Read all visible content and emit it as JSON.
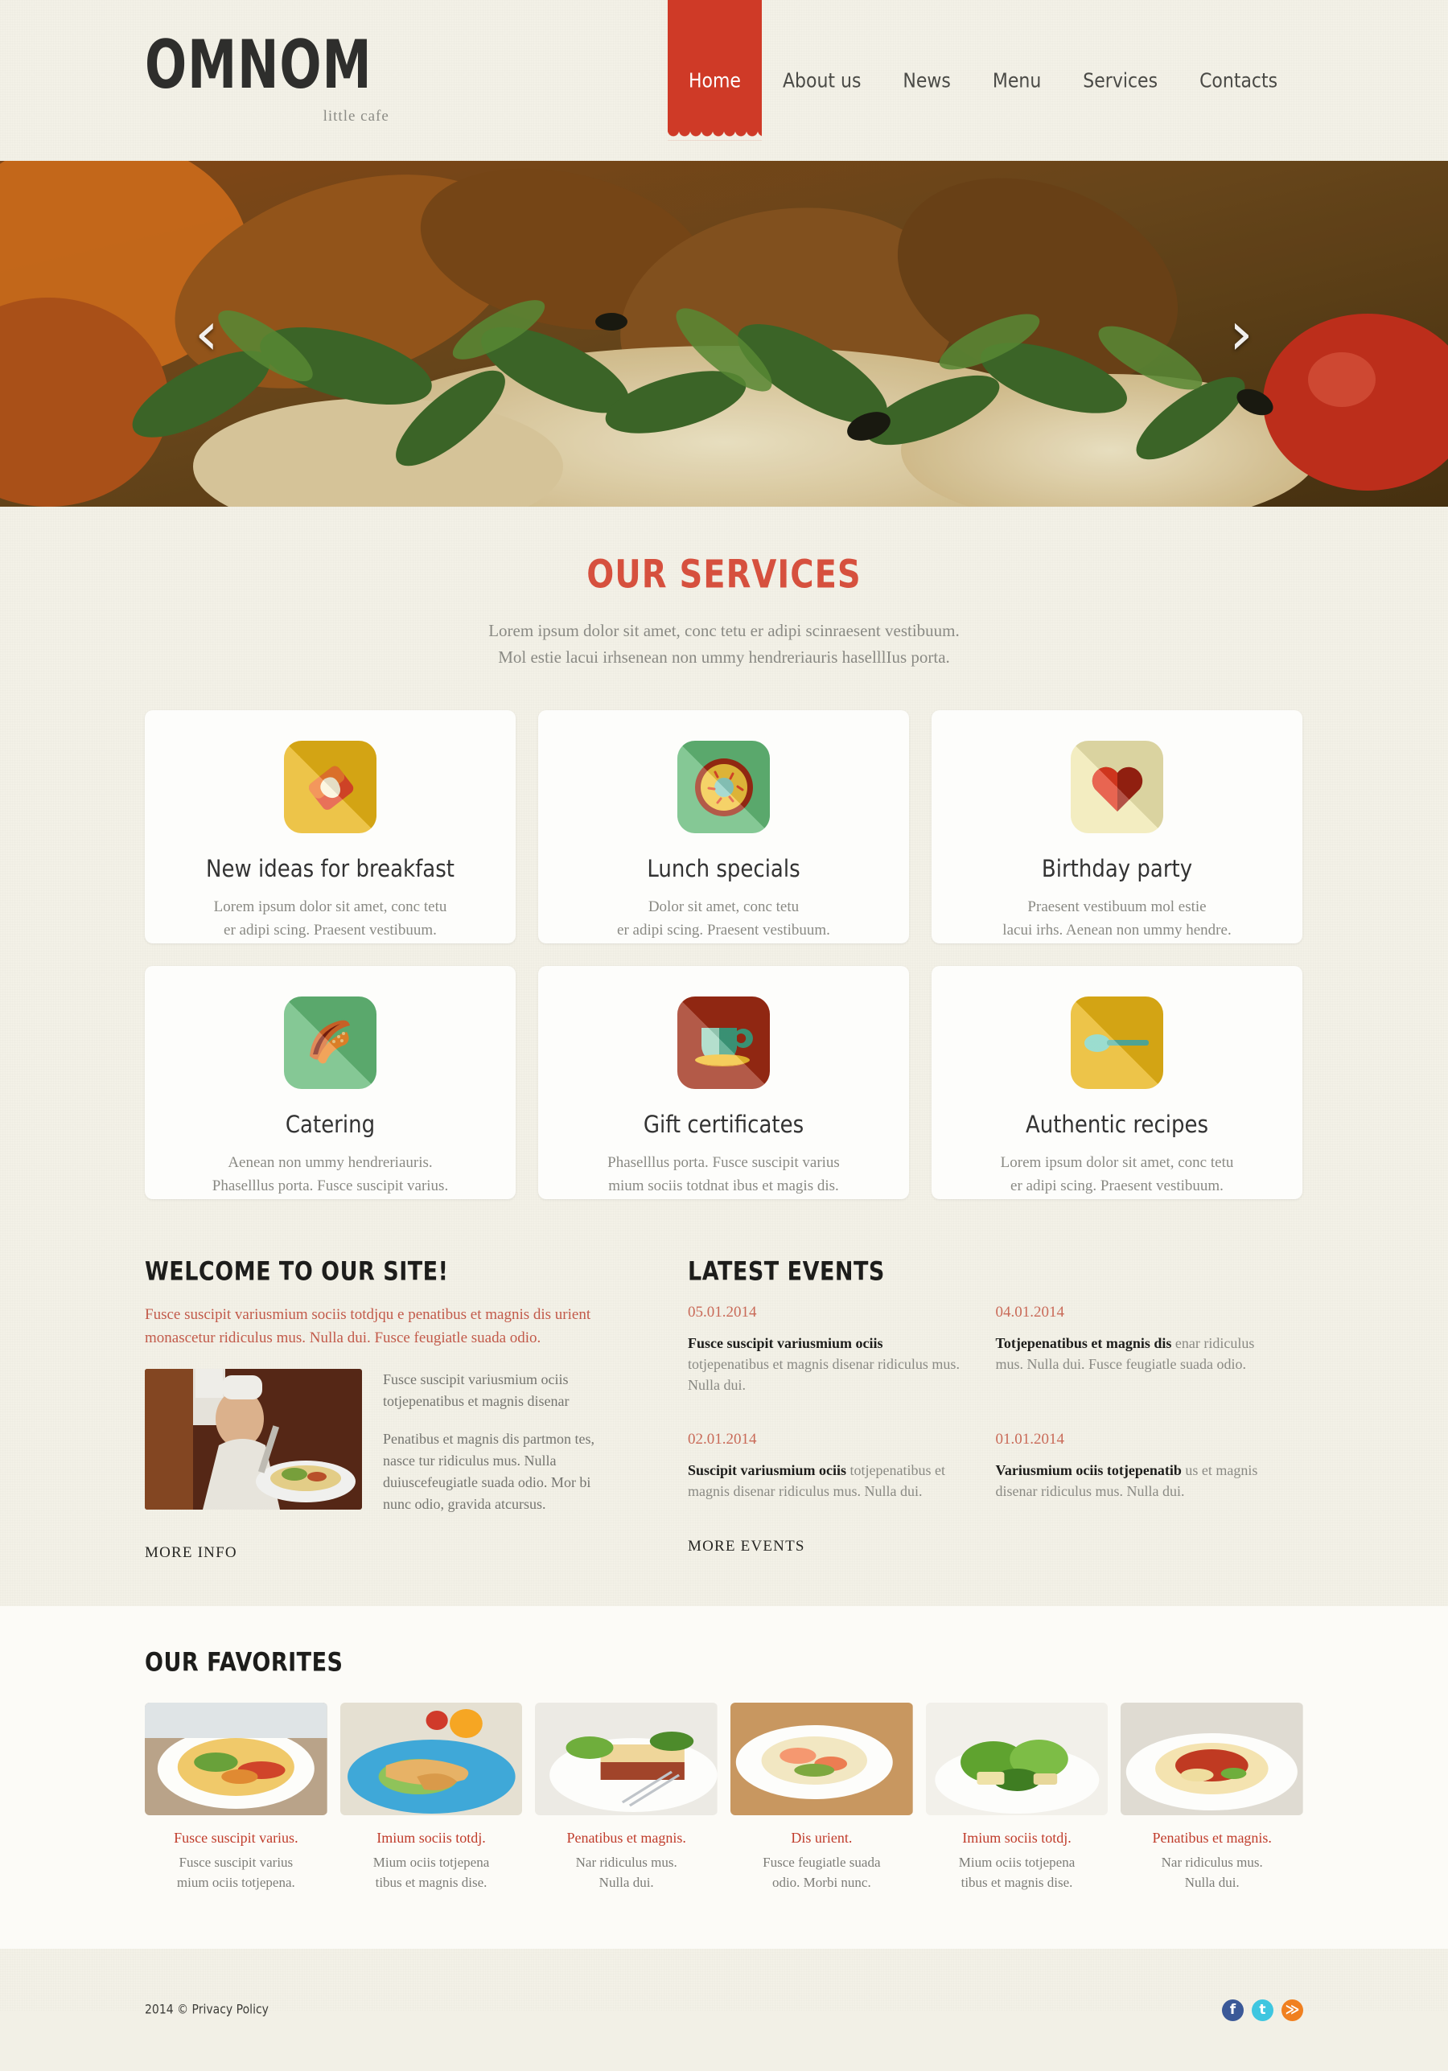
{
  "brand": {
    "name": "OMNOM",
    "tagline": "little cafe"
  },
  "nav": {
    "items": [
      {
        "label": "Home",
        "active": true
      },
      {
        "label": "About us",
        "active": false
      },
      {
        "label": "News",
        "active": false
      },
      {
        "label": "Menu",
        "active": false
      },
      {
        "label": "Services",
        "active": false
      },
      {
        "label": "Contacts",
        "active": false
      }
    ]
  },
  "slider": {
    "prev_icon": "chevron-left",
    "next_icon": "chevron-right"
  },
  "services": {
    "title": "OUR SERVICES",
    "subtitle_line1": "Lorem ipsum dolor sit amet, conc tetu  er adipi scinraesent vestibuum.",
    "subtitle_line2": "Mol estie lacui irhsenean non ummy hendreriauris haselllIus porta.",
    "cards": [
      {
        "title": "New ideas for breakfast",
        "desc_line1": "Lorem ipsum dolor sit amet, conc tetu",
        "desc_line2": "er adipi scing. Praesent vestibuum.",
        "icon": "toast-bread-icon",
        "bg": "#e8b416"
      },
      {
        "title": "Lunch specials",
        "desc_line1": "Dolor sit amet, conc tetu",
        "desc_line2": "er adipi scing. Praesent vestibuum.",
        "icon": "donut-icon",
        "bg": "#63b977"
      },
      {
        "title": "Birthday party",
        "desc_line1": "Praesent vestibuum mol estie",
        "desc_line2": "lacui irhs. Aenean non ummy hendre.",
        "icon": "heart-icon",
        "bg": "#f0e8b0"
      },
      {
        "title": "Catering",
        "desc_line1": "Aenean non ummy hendreriauris.",
        "desc_line2": "Phaselllus porta. Fusce suscipit varius.",
        "icon": "croissant-icon",
        "bg": "#63b977"
      },
      {
        "title": "Gift certificates",
        "desc_line1": "Phaselllus porta. Fusce suscipit varius",
        "desc_line2": "mium sociis totdnat ibus et magis dis.",
        "icon": "coffee-cup-icon",
        "bg": "#9e2b14"
      },
      {
        "title": "Authentic recipes",
        "desc_line1": "Lorem ipsum dolor sit amet, conc tetu",
        "desc_line2": "er adipi scing. Praesent vestibuum.",
        "icon": "spoon-icon",
        "bg": "#e8b416"
      }
    ]
  },
  "welcome": {
    "title": "WELCOME TO OUR SITE!",
    "intro": "Fusce suscipit variusmium sociis totdjqu e penatibus et magnis dis urient monascetur ridiculus mus. Nulla dui. Fusce feugiatle suada odio.",
    "photo_alt": "chef-photo",
    "paragraph1": "Fusce suscipit variusmium ociis totjepenatibus et magnis disenar",
    "paragraph2": "Penatibus et magnis dis partmon tes, nasce tur ridiculus mus. Nulla duiuscefeugiatle suada odio. Mor bi nunc odio, gravida atcursus.",
    "more_label": "MORE INFO"
  },
  "events": {
    "title": "LATEST EVENTS",
    "more_label": "MORE EVENTS",
    "items": [
      {
        "date": "05.01.2014",
        "headline": "Fusce suscipit variusmium ociis",
        "body": "totjepenatibus et magnis disenar ridiculus mus. Nulla dui."
      },
      {
        "date": "04.01.2014",
        "headline": "Totjepenatibus et magnis dis",
        "body": "enar ridiculus mus. Nulla dui. Fusce feugiatle suada odio."
      },
      {
        "date": "02.01.2014",
        "headline": "Suscipit variusmium ociis",
        "body": "totjepenatibus et magnis disenar ridiculus mus. Nulla dui."
      },
      {
        "date": "01.01.2014",
        "headline": "Variusmium ociis totjepenatib",
        "body": "us et magnis disenar ridiculus mus. Nulla dui."
      }
    ]
  },
  "favorites": {
    "title": "OUR FAVORITES",
    "items": [
      {
        "title": "Fusce suscipit varius.",
        "desc_line1": "Fusce suscipit varius",
        "desc_line2": "mium ociis totjepena.",
        "image": "pasta-vegetables-plate"
      },
      {
        "title": "Imium sociis totdj.",
        "desc_line1": "Mium ociis totjepena",
        "desc_line2": "tibus et magnis dise.",
        "image": "wrap-blue-plate"
      },
      {
        "title": "Penatibus et magnis.",
        "desc_line1": "Nar ridiculus mus.",
        "desc_line2": "Nulla dui.",
        "image": "lasagna-salad-plate"
      },
      {
        "title": "Dis urient.",
        "desc_line1": "Fusce feugiatle suada",
        "desc_line2": "odio. Morbi nunc.",
        "image": "shrimp-pasta-board"
      },
      {
        "title": "Imium sociis totdj.",
        "desc_line1": "Mium ociis totjepena",
        "desc_line2": "tibus et magnis dise.",
        "image": "green-salad-plate"
      },
      {
        "title": "Penatibus et magnis.",
        "desc_line1": "Nar ridiculus mus.",
        "desc_line2": "Nulla dui.",
        "image": "spaghetti-bolognese-plate"
      }
    ]
  },
  "footer": {
    "copyright": "2014 © Privacy Policy",
    "socials": [
      {
        "name": "facebook",
        "glyph": "f",
        "color": "#3b5998"
      },
      {
        "name": "twitter",
        "glyph": "t",
        "color": "#3ec6e0"
      },
      {
        "name": "rss",
        "glyph": "≫",
        "color": "#f08020"
      }
    ]
  },
  "colors": {
    "accent": "#cf3a27",
    "heading": "#d6503e",
    "link": "#c03c2b",
    "page_bg": "#f3f1e7"
  }
}
